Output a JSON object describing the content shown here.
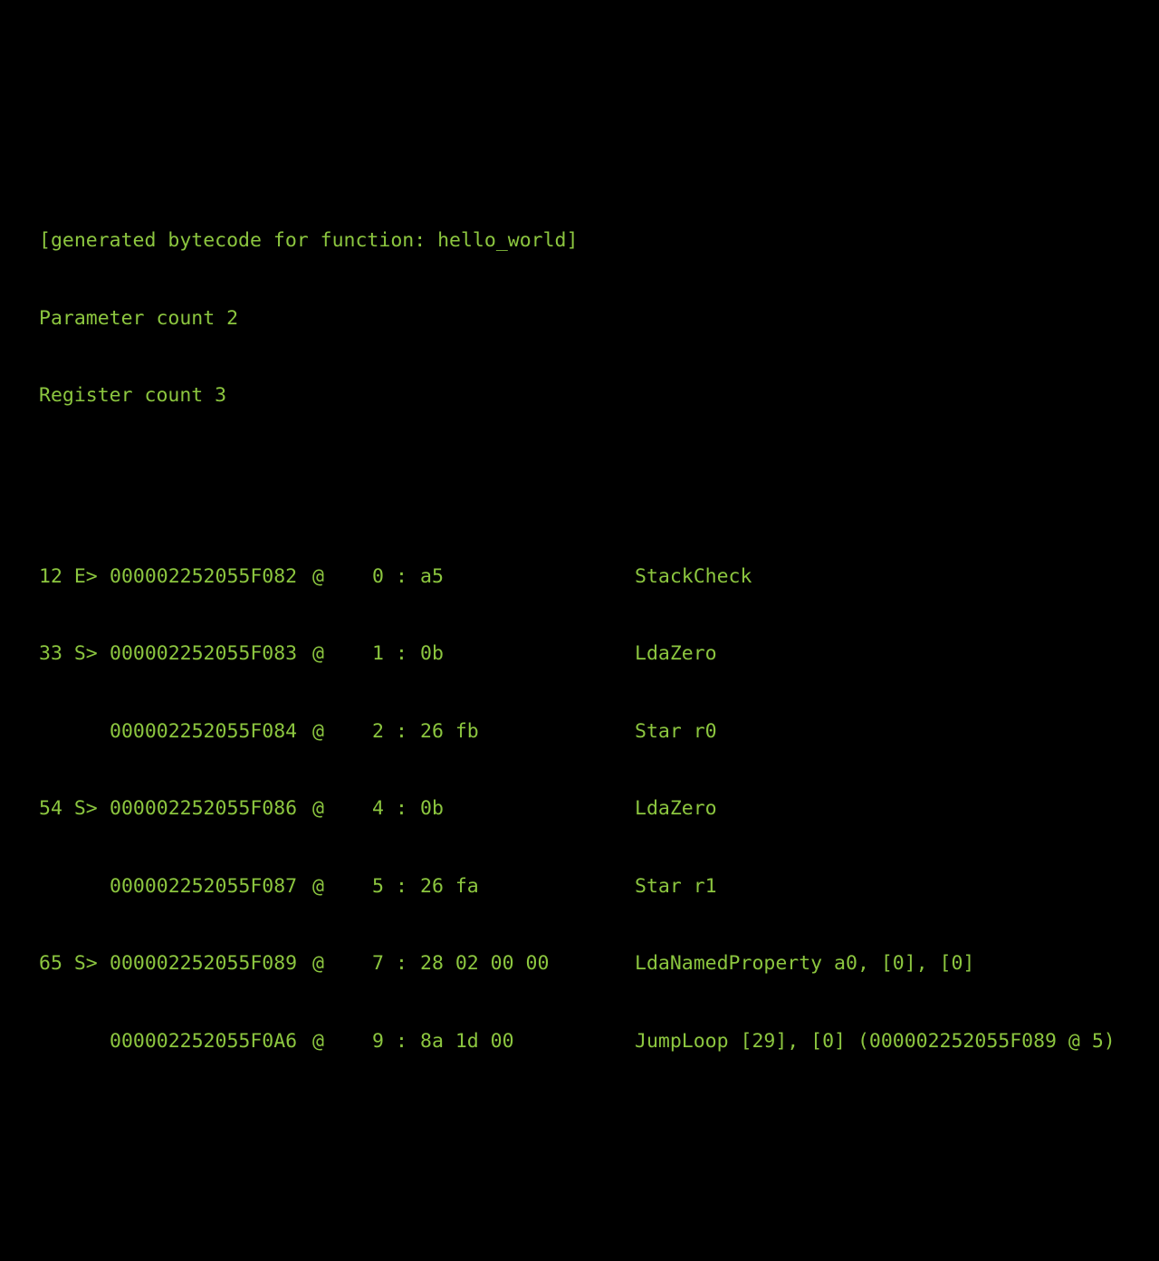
{
  "colors": {
    "background": "#000000",
    "text": "#8cc63f"
  },
  "header": {
    "title": "[generated bytecode for function: hello_world]",
    "parameter_count": "Parameter count 2",
    "register_count": "Register count 3"
  },
  "bytecode": [
    {
      "source": "12 E>",
      "address": "000002252055F082",
      "at": "@",
      "offset": "0",
      "colon": ":",
      "bytes": "a5",
      "instruction": "StackCheck"
    },
    {
      "source": "33 S>",
      "address": "000002252055F083",
      "at": "@",
      "offset": "1",
      "colon": ":",
      "bytes": "0b",
      "instruction": "LdaZero"
    },
    {
      "source": "",
      "address": "000002252055F084",
      "at": "@",
      "offset": "2",
      "colon": ":",
      "bytes": "26 fb",
      "instruction": "Star r0"
    },
    {
      "source": "54 S>",
      "address": "000002252055F086",
      "at": "@",
      "offset": "4",
      "colon": ":",
      "bytes": "0b",
      "instruction": "LdaZero"
    },
    {
      "source": "",
      "address": "000002252055F087",
      "at": "@",
      "offset": "5",
      "colon": ":",
      "bytes": "26 fa",
      "instruction": "Star r1"
    },
    {
      "source": "65 S>",
      "address": "000002252055F089",
      "at": "@",
      "offset": "7",
      "colon": ":",
      "bytes": "28 02 00 00",
      "instruction": "LdaNamedProperty a0, [0], [0]"
    },
    {
      "source": "",
      "address": "000002252055F0A6",
      "at": "@",
      "offset": "9",
      "colon": ":",
      "bytes": "8a 1d 00",
      "instruction": "JumpLoop [29], [0] (000002252055F089 @ 5)"
    }
  ]
}
